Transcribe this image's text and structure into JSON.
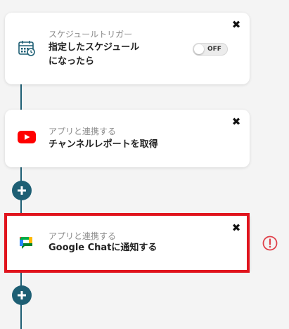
{
  "steps": [
    {
      "subtitle": "スケジュールトリガー",
      "title_line1": "指定したスケジュール",
      "title_line2": "になったら",
      "icon": "calendar-clock-icon",
      "toggle_label": "OFF"
    },
    {
      "subtitle": "アプリと連携する",
      "title": "チャンネルレポートを取得",
      "icon": "youtube-icon"
    },
    {
      "subtitle": "アプリと連携する",
      "title": "Google Chatに通知する",
      "icon": "google-chat-icon",
      "highlighted": true,
      "status": "error"
    }
  ],
  "colors": {
    "connector": "#1e5f74",
    "highlight": "#e0141d",
    "warning": "#e0414a",
    "youtube": "#ff0000"
  }
}
